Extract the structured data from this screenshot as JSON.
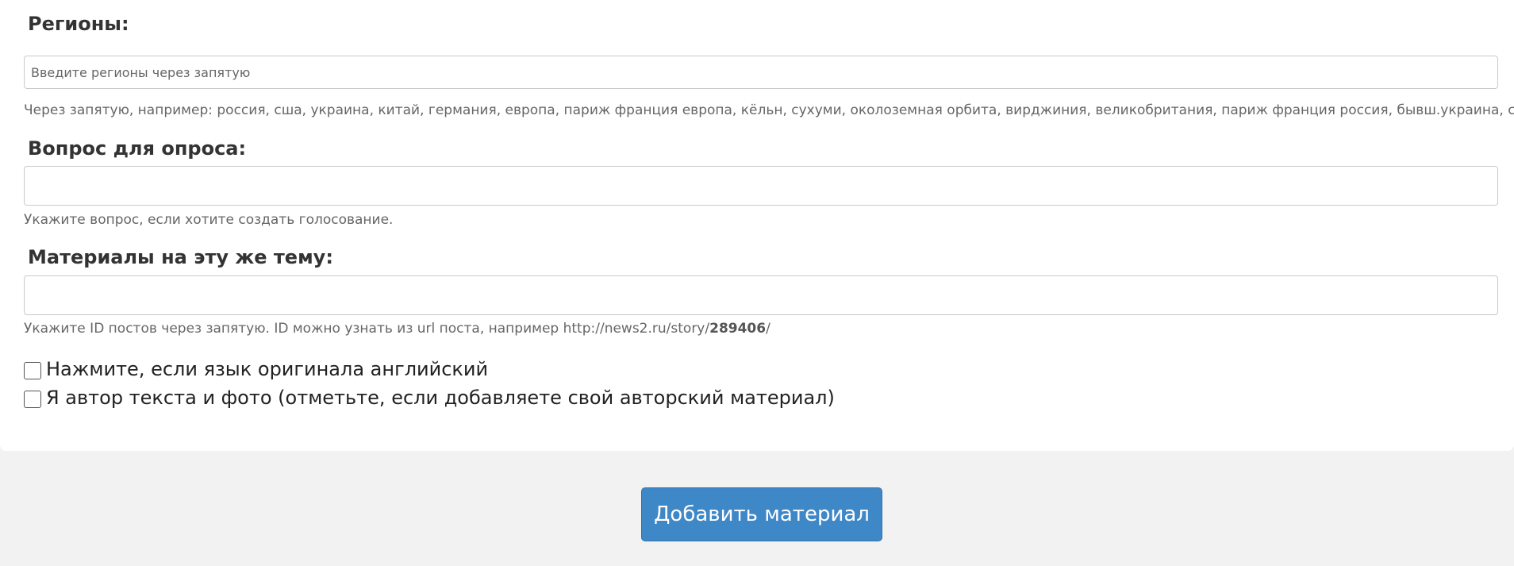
{
  "form": {
    "regions": {
      "label": "Регионы:",
      "placeholder": "Введите регионы через запятую",
      "value": "",
      "hint": "Через запятую, например: россия, сша, украина, китай, германия, европа, париж франция европа, кёльн, сухуми, околоземная орбита, вирджиния, великобритания, париж франция россия, бывш.украина, счастье"
    },
    "poll": {
      "label": "Вопрос для опроса:",
      "value": "",
      "hint": "Укажите вопрос, если хотите создать голосование."
    },
    "related": {
      "label": "Материалы на эту же тему:",
      "value": "",
      "hint_prefix": "Укажите ID постов через запятую. ID можно узнать из url поста, например http://news2.ru/story/",
      "hint_id": "289406",
      "hint_suffix": "/"
    },
    "checkboxes": [
      {
        "label": "Нажмите, если язык оригинала английский",
        "checked": false
      },
      {
        "label": "Я автор текста и фото (отметьте, если добавляете свой авторский материал)",
        "checked": false
      }
    ]
  },
  "actions": {
    "submit_label": "Добавить материал"
  },
  "colors": {
    "background": "#f2f2f2",
    "card": "#ffffff",
    "button": "#3f88c8",
    "hint_text": "#666666"
  }
}
